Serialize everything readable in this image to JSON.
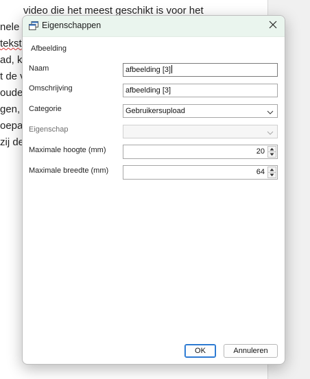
{
  "background_doc": {
    "lines": [
      "video die het meest geschikt is voor het",
      "nele",
      "tekst",
      "ad, k",
      "t de v",
      "ouder",
      "gen, g",
      "oepa",
      "zij de"
    ]
  },
  "dialog": {
    "title": "Eigenschappen",
    "icon": "properties-window-icon",
    "close_icon": "close-icon",
    "section": "Afbeelding",
    "fields": {
      "naam": {
        "label": "Naam",
        "value": "afbeelding [3]"
      },
      "omschrijving": {
        "label": "Omschrijving",
        "value": "afbeelding [3]"
      },
      "categorie": {
        "label": "Categorie",
        "value": "Gebruikersupload"
      },
      "eigenschap": {
        "label": "Eigenschap",
        "value": ""
      },
      "hoogte": {
        "label": "Maximale hoogte (mm)",
        "value": "20"
      },
      "breedte": {
        "label": "Maximale breedte (mm)",
        "value": "64"
      }
    },
    "buttons": {
      "ok": "OK",
      "cancel": "Annuleren"
    }
  },
  "colors": {
    "titlebar": "#eaf5ee",
    "primary_border": "#1f6fc9"
  }
}
